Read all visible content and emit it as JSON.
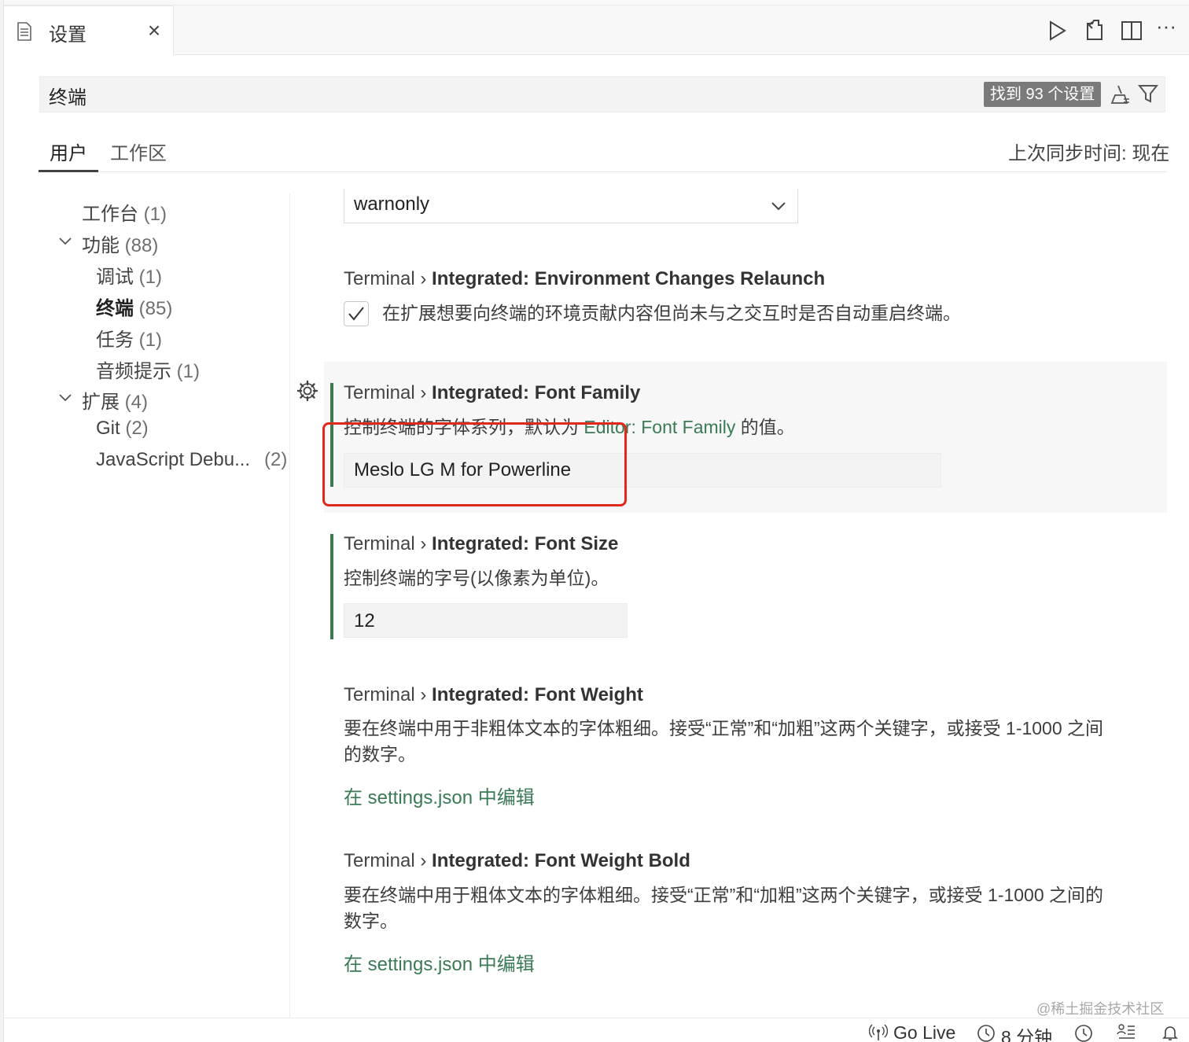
{
  "tab": {
    "label": "设置",
    "close_symbol": "×"
  },
  "toolbar": {
    "icons": [
      "run-icon",
      "open-settings-json-icon",
      "split-editor-icon",
      "more-actions-icon"
    ],
    "more_symbol": "···"
  },
  "search": {
    "value": "终端",
    "result_badge": "找到 93 个设置"
  },
  "scope": {
    "user": "用户",
    "workspace": "工作区",
    "last_sync": "上次同步时间: 现在"
  },
  "toc": [
    {
      "label": "工作台",
      "count": "(1)",
      "level": 0
    },
    {
      "label": "功能",
      "count": "(88)",
      "level": 0,
      "expanded": true
    },
    {
      "label": "调试",
      "count": "(1)",
      "level": 1
    },
    {
      "label": "终端",
      "count": "(85)",
      "level": 1,
      "active": true
    },
    {
      "label": "任务",
      "count": "(1)",
      "level": 1
    },
    {
      "label": "音频提示",
      "count": "(1)",
      "level": 1
    },
    {
      "label": "扩展",
      "count": "(4)",
      "level": 0,
      "expanded": true
    },
    {
      "label": "Git",
      "count": "(2)",
      "level": 1
    },
    {
      "label": "JavaScript Debu...",
      "count": "(2)",
      "level": 1
    }
  ],
  "settings": {
    "prev_select": {
      "value": "warnonly"
    },
    "relaunch": {
      "prefix": "Terminal › ",
      "name": "Integrated: Environment Changes Relaunch",
      "desc": "在扩展想要向终端的环境贡献内容但尚未与之交互时是否自动重启终端。",
      "checked": true
    },
    "font_family": {
      "prefix": "Terminal › ",
      "name": "Integrated: Font Family",
      "desc_before": "控制终端的字体系列，默认为 ",
      "desc_link": "Editor: Font Family",
      "desc_after": " 的值。",
      "value": "Meslo LG M for Powerline"
    },
    "font_size": {
      "prefix": "Terminal › ",
      "name": "Integrated: Font Size",
      "desc": "控制终端的字号(以像素为单位)。",
      "value": "12"
    },
    "font_weight": {
      "prefix": "Terminal › ",
      "name": "Integrated: Font Weight",
      "desc_line1": "要在终端中用于非粗体文本的字体粗细。接受“正常”和“加粗”这两个关键字，或接受 1-1000 之间",
      "desc_line2": "的数字。",
      "link": "在 settings.json 中编辑"
    },
    "font_weight_bold": {
      "prefix": "Terminal › ",
      "name": "Integrated: Font Weight Bold",
      "desc_line1": "要在终端中用于粗体文本的字体粗细。接受“正常”和“加粗”这两个关键字，或接受 1-1000 之间的",
      "desc_line2": "数字。",
      "link": "在 settings.json 中编辑"
    }
  },
  "status": {
    "go_live": "Go Live",
    "timer": "8 分钟"
  },
  "watermark": "@稀土掘金技术社区",
  "colors": {
    "modified_bar": "#3d7a52",
    "link": "#3a7a55",
    "highlight": "#e0281e",
    "badge": "#7a7a7a"
  }
}
